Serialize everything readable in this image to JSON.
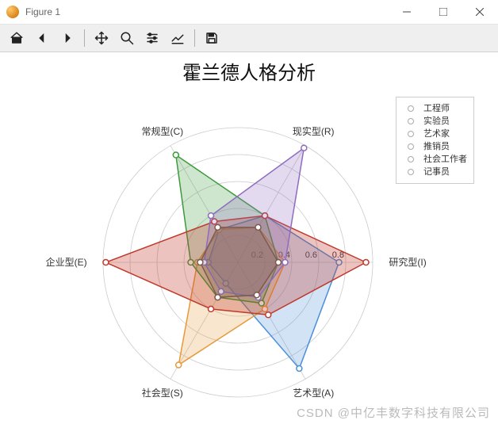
{
  "window": {
    "title": "Figure 1"
  },
  "toolbar": {
    "items": [
      "home",
      "back",
      "forward",
      "sep",
      "pan",
      "zoom",
      "subplots",
      "axes",
      "sep2",
      "save"
    ]
  },
  "chart_data": {
    "type": "radar",
    "title": "霍兰德人格分析",
    "axes": [
      "研究型(I)",
      "艺术型(A)",
      "社会型(S)",
      "企业型(E)",
      "常规型(C)",
      "现实型(R)"
    ],
    "ticks": [
      0.2,
      0.4,
      0.6,
      0.8
    ],
    "rmax": 1.0,
    "legend_position": "upper right",
    "series": [
      {
        "name": "工程师",
        "color": "#4a90d9",
        "fill": "rgba(74,144,217,0.25)",
        "values": [
          0.75,
          0.91,
          0.18,
          0.22,
          0.28,
          0.4
        ]
      },
      {
        "name": "实验员",
        "color": "#e59a3b",
        "fill": "rgba(229,154,59,0.25)",
        "values": [
          0.35,
          0.4,
          0.88,
          0.3,
          0.28,
          0.3
        ]
      },
      {
        "name": "艺术家",
        "color": "#3c9a3c",
        "fill": "rgba(60,154,60,0.25)",
        "values": [
          0.3,
          0.35,
          0.3,
          0.35,
          0.92,
          0.4
        ]
      },
      {
        "name": "推销员",
        "color": "#c0392b",
        "fill": "rgba(192,57,43,0.30)",
        "values": [
          0.95,
          0.45,
          0.4,
          0.98,
          0.35,
          0.4
        ]
      },
      {
        "name": "社会工作者",
        "color": "#8e6cc0",
        "fill": "rgba(142,108,192,0.25)",
        "values": [
          0.35,
          0.3,
          0.25,
          0.25,
          0.4,
          0.98
        ]
      },
      {
        "name": "记事员",
        "color": "#7d5a4f",
        "fill": "rgba(125,90,79,0.25)",
        "values": [
          0.3,
          0.28,
          0.3,
          0.28,
          0.3,
          0.3
        ]
      }
    ]
  },
  "watermark": "CSDN @中亿丰数字科技有限公司"
}
